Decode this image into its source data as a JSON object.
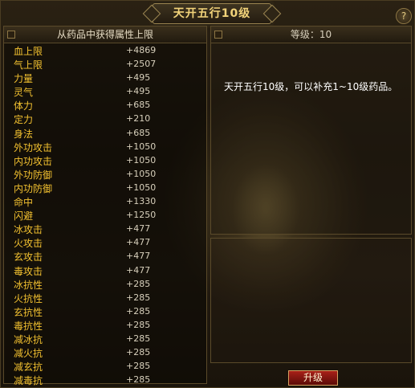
{
  "window": {
    "title": "天开五行10级",
    "close_label": "?"
  },
  "left_panel": {
    "header": "从药品中获得属性上限",
    "stats": [
      {
        "name": "血上限",
        "value": "+4869"
      },
      {
        "name": "气上限",
        "value": "+2507"
      },
      {
        "name": "力量",
        "value": "+495"
      },
      {
        "name": "灵气",
        "value": "+495"
      },
      {
        "name": "体力",
        "value": "+685"
      },
      {
        "name": "定力",
        "value": "+210"
      },
      {
        "name": "身法",
        "value": "+685"
      },
      {
        "name": "外功攻击",
        "value": "+1050"
      },
      {
        "name": "内功攻击",
        "value": "+1050"
      },
      {
        "name": "外功防御",
        "value": "+1050"
      },
      {
        "name": "内功防御",
        "value": "+1050"
      },
      {
        "name": "命中",
        "value": "+1330"
      },
      {
        "name": "闪避",
        "value": "+1250"
      },
      {
        "name": "冰攻击",
        "value": "+477"
      },
      {
        "name": "火攻击",
        "value": "+477"
      },
      {
        "name": "玄攻击",
        "value": "+477"
      },
      {
        "name": "毒攻击",
        "value": "+477"
      },
      {
        "name": "冰抗性",
        "value": "+285"
      },
      {
        "name": "火抗性",
        "value": "+285"
      },
      {
        "name": "玄抗性",
        "value": "+285"
      },
      {
        "name": "毒抗性",
        "value": "+285"
      },
      {
        "name": "减冰抗",
        "value": "+285"
      },
      {
        "name": "减火抗",
        "value": "+285"
      },
      {
        "name": "减玄抗",
        "value": "+285"
      },
      {
        "name": "减毒抗",
        "value": "+285"
      }
    ]
  },
  "right_panel": {
    "level_label": "等级：10",
    "description": "天开五行10级，可以补充1~10级药品。"
  },
  "actions": {
    "upgrade_label": "升级"
  },
  "colors": {
    "stat_name": "#f4c230",
    "title_text": "#f2d37a",
    "button_bg": "#a82018"
  }
}
